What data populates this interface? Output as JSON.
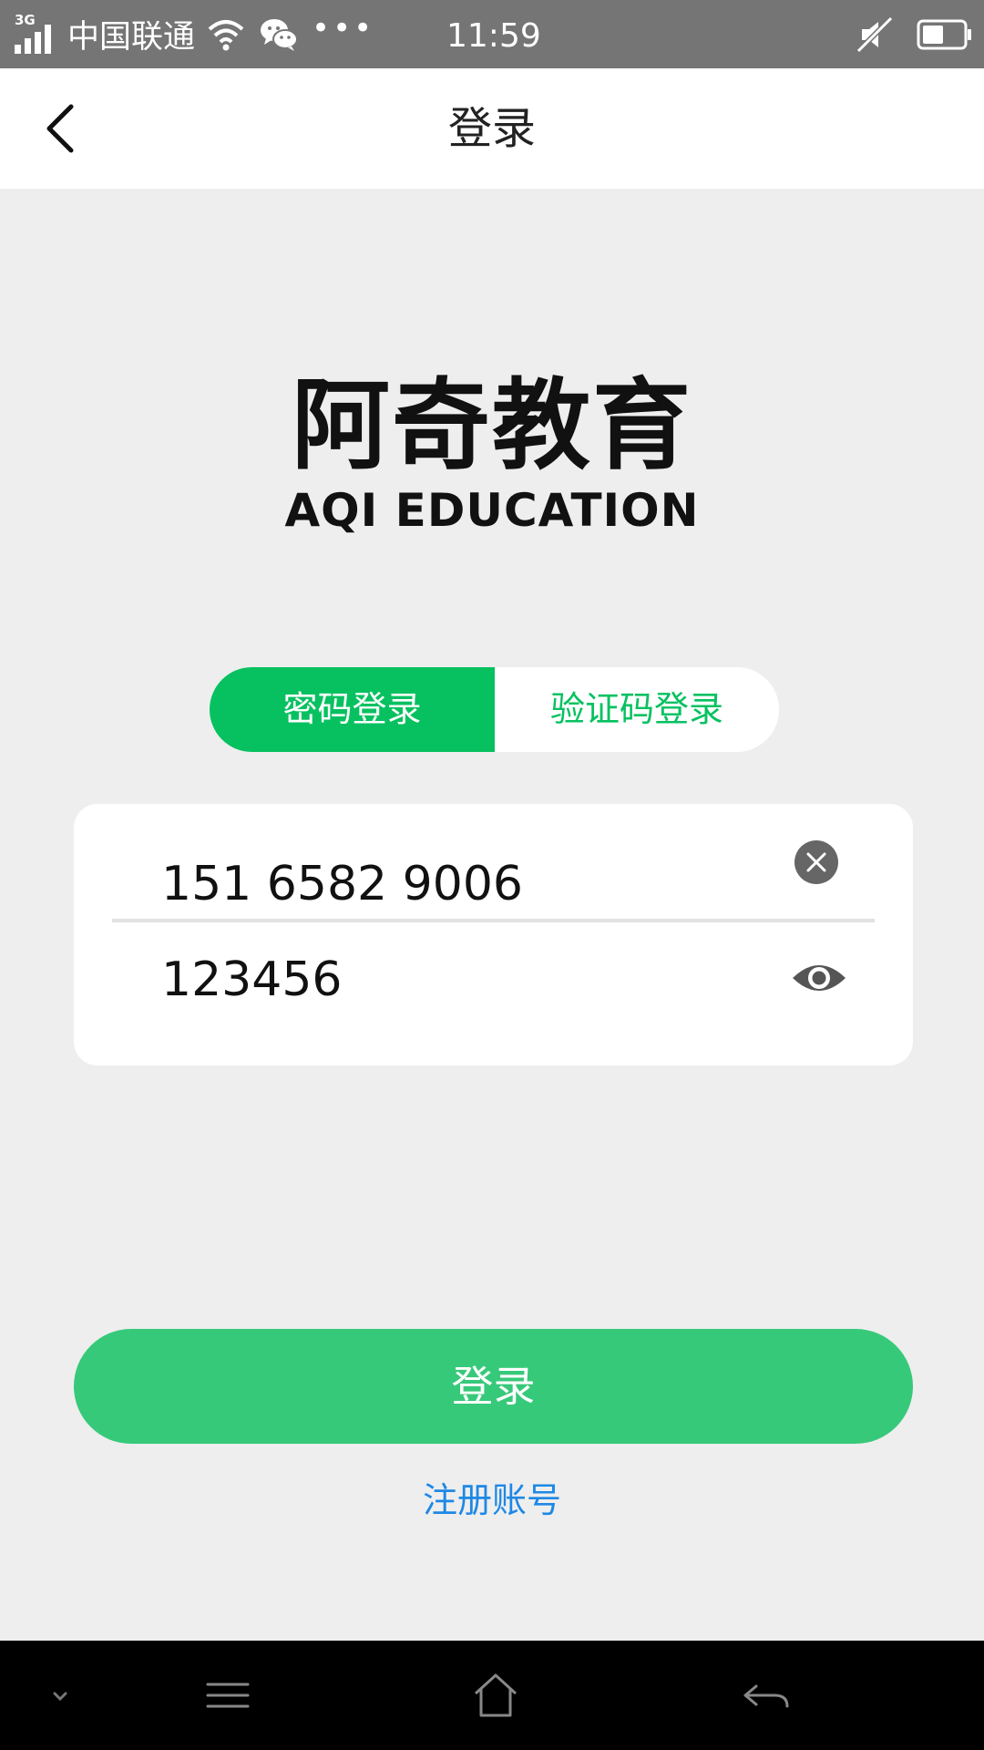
{
  "status_bar": {
    "network_type": "3G",
    "carrier": "中国联通",
    "dots": "•••",
    "time": "11:59",
    "icons": [
      "signal-icon",
      "wifi-icon",
      "wechat-icon",
      "mute-icon",
      "battery-icon"
    ]
  },
  "header": {
    "title": "登录",
    "back_icon": "chevron-left-icon"
  },
  "logo": {
    "name_cn": "阿奇教育",
    "name_en": "AQI EDUCATION"
  },
  "login_tabs": [
    {
      "label": "密码登录",
      "selected": true
    },
    {
      "label": "验证码登录",
      "selected": false
    }
  ],
  "form": {
    "phone_value": "151 6582 9006",
    "password_value": "123456",
    "clear_icon": "clear-circle-icon",
    "visibility_icon": "eye-icon"
  },
  "actions": {
    "login_label": "登录",
    "register_label": "注册账号"
  },
  "nav_bar": {
    "icons": [
      "chevron-down-icon",
      "menu-icon",
      "home-icon",
      "back-arrow-icon"
    ]
  },
  "colors": {
    "accent_green": "#07c160",
    "button_green": "#37c97a",
    "link_blue": "#1e88e5",
    "status_bar_bg": "#757575",
    "page_bg": "#eeeeee"
  }
}
